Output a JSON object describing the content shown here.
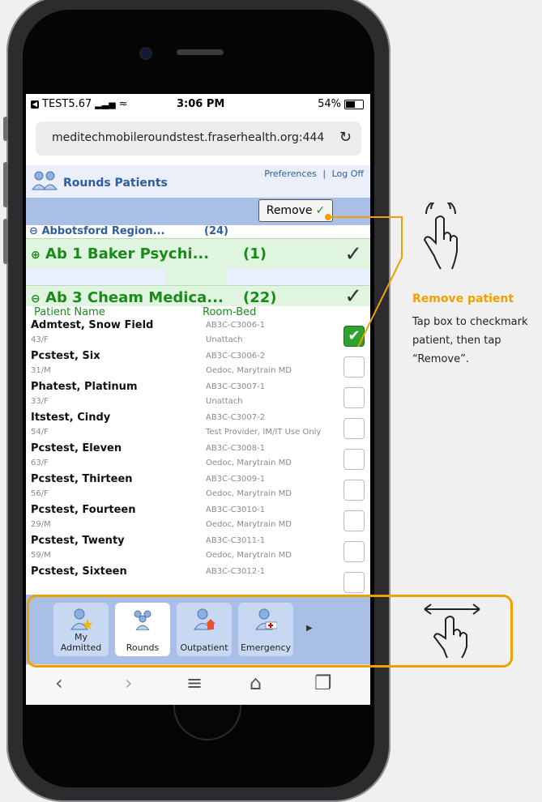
{
  "status_bar": {
    "carrier": "TEST5.67",
    "time": "3:06 PM",
    "battery": "54%"
  },
  "browser": {
    "url": "meditechmobileroundstest.fraserhealth.org:444"
  },
  "app_header": {
    "title": "Rounds Patients",
    "preferences": "Preferences",
    "separator": "|",
    "logoff": "Log Off"
  },
  "remove_button": {
    "label": "Remove"
  },
  "region": {
    "name": "Abbotsford Region...",
    "count": "(24)"
  },
  "units": [
    {
      "name": "Ab 1 Baker Psychi...",
      "count": "(1)"
    },
    {
      "name": "Ab 3 Cheam Medica...",
      "count": "(22)"
    }
  ],
  "columns": {
    "patient_name": "Patient Name",
    "room_bed": "Room-Bed"
  },
  "patients": [
    {
      "name": "Admtest, Snow Field",
      "age_sex": "43/F",
      "room": "AB3C-C3006-1",
      "provider": "Unattach",
      "checked": true
    },
    {
      "name": "Pcstest, Six",
      "age_sex": "31/M",
      "room": "AB3C-C3006-2",
      "provider": "Oedoc, Marytrain MD",
      "checked": false
    },
    {
      "name": "Phatest, Platinum",
      "age_sex": "33/F",
      "room": "AB3C-C3007-1",
      "provider": "Unattach",
      "checked": false
    },
    {
      "name": "Itstest, Cindy",
      "age_sex": "54/F",
      "room": "AB3C-C3007-2",
      "provider": "Test Provider, IM/IT Use Only",
      "checked": false
    },
    {
      "name": "Pcstest, Eleven",
      "age_sex": "63/F",
      "room": "AB3C-C3008-1",
      "provider": "Oedoc, Marytrain MD",
      "checked": false
    },
    {
      "name": "Pcstest, Thirteen",
      "age_sex": "56/F",
      "room": "AB3C-C3009-1",
      "provider": "Oedoc, Marytrain MD",
      "checked": false
    },
    {
      "name": "Pcstest, Fourteen",
      "age_sex": "29/M",
      "room": "AB3C-C3010-1",
      "provider": "Oedoc, Marytrain MD",
      "checked": false
    },
    {
      "name": "Pcstest, Twenty",
      "age_sex": "59/M",
      "room": "AB3C-C3011-1",
      "provider": "Oedoc, Marytrain MD",
      "checked": false
    },
    {
      "name": "Pcstest, Sixteen",
      "age_sex": "",
      "room": "AB3C-C3012-1",
      "provider": "",
      "checked": false
    }
  ],
  "tabs": [
    {
      "label_line1": "My",
      "label_line2": "Admitted",
      "icon": "person-star-icon"
    },
    {
      "label_line1": "Rounds",
      "label_line2": "",
      "icon": "people-group-icon"
    },
    {
      "label_line1": "Outpatient",
      "label_line2": "",
      "icon": "person-house-icon"
    },
    {
      "label_line1": "Emergency",
      "label_line2": "",
      "icon": "person-ambulance-icon"
    }
  ],
  "annotation": {
    "title": "Remove patient",
    "body": "Tap box to checkmark patient, then tap “Remove”."
  },
  "colors": {
    "accent_orange": "#f0a000",
    "link_blue": "#2c5ea0",
    "unit_green": "#1a8a1a",
    "band_blue": "#a9bfe6"
  }
}
